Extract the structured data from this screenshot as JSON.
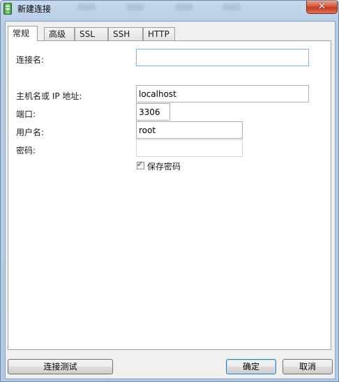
{
  "window": {
    "title": "新建连接",
    "close_label": "✕"
  },
  "tabs": [
    {
      "label": "常规",
      "active": true
    },
    {
      "label": "高级",
      "active": false
    },
    {
      "label": "SSL",
      "active": false
    },
    {
      "label": "SSH",
      "active": false
    },
    {
      "label": "HTTP",
      "active": false
    }
  ],
  "form": {
    "connection_name": {
      "label": "连接名:",
      "value": ""
    },
    "host": {
      "label": "主机名或 IP 地址:",
      "value": "localhost"
    },
    "port": {
      "label": "端口:",
      "value": "3306"
    },
    "username": {
      "label": "用户名:",
      "value": "root"
    },
    "password": {
      "label": "密码:",
      "value": ""
    },
    "save_password": {
      "label": "保存密码",
      "checked": true
    }
  },
  "buttons": {
    "test_connection": "连接测试",
    "ok": "确定",
    "cancel": "取消"
  },
  "icons": {
    "check_glyph": "✓"
  }
}
